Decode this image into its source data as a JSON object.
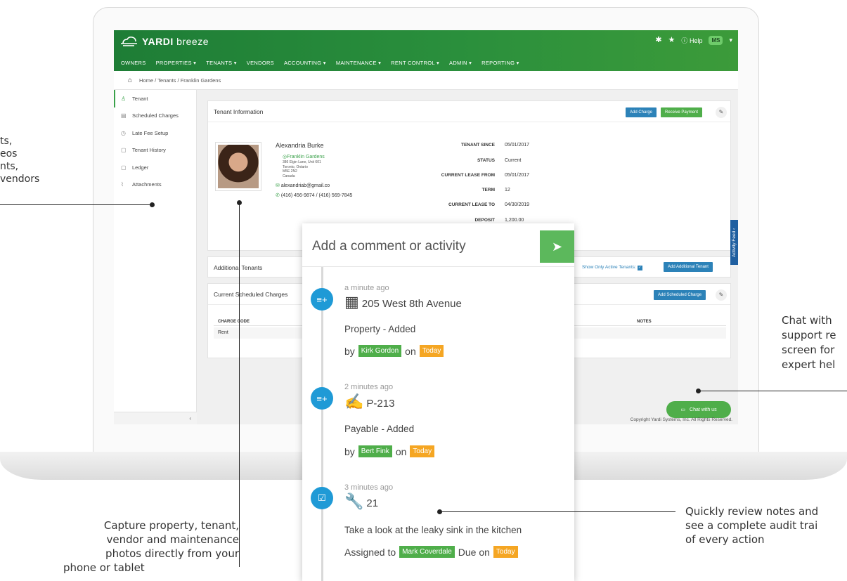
{
  "app": {
    "logo": "YARDI",
    "logo_suffix": "breeze",
    "help": "Help",
    "user_initials": "MS"
  },
  "nav": [
    "OWNERS",
    "PROPERTIES ▾",
    "TENANTS ▾",
    "VENDORS",
    "ACCOUNTING ▾",
    "MAINTENANCE ▾",
    "RENT CONTROL ▾",
    "ADMIN ▾",
    "REPORTING ▾"
  ],
  "breadcrumb": "Home / Tenants / Franklin Gardens",
  "sidebar": {
    "items": [
      {
        "label": "Tenant",
        "icon": "user-icon"
      },
      {
        "label": "Scheduled Charges",
        "icon": "calendar-icon"
      },
      {
        "label": "Late Fee Setup",
        "icon": "clock-icon"
      },
      {
        "label": "Tenant History",
        "icon": "document-icon"
      },
      {
        "label": "Ledger",
        "icon": "ledger-icon"
      },
      {
        "label": "Attachments",
        "icon": "paperclip-icon"
      }
    ],
    "collapse": "‹"
  },
  "tenant_info": {
    "title": "Tenant Information",
    "add_charge": "Add Charge",
    "receive_payment": "Receive Payment",
    "name": "Alexandria Burke",
    "property": "Franklin Gardens",
    "address": [
      "386 Elgin Lane, Unit 601",
      "Toronto, Ontario",
      "M5E 2N2",
      "Canada"
    ],
    "email": "alexandriab@gmail.co",
    "phone": "(416) 456-9874  /  (416) 569-7845",
    "fields": [
      {
        "key": "TENANT SINCE",
        "value": "05/01/2017"
      },
      {
        "key": "STATUS",
        "value": "Current"
      },
      {
        "key": "CURRENT LEASE FROM",
        "value": "05/01/2017"
      },
      {
        "key": "TERM",
        "value": "12"
      },
      {
        "key": "CURRENT LEASE TO",
        "value": "04/30/2019"
      },
      {
        "key": "DEPOSIT",
        "value": "1,200.00"
      }
    ]
  },
  "additional_tenants": {
    "title": "Additional Tenants",
    "filter_label": "Show Only Active Tenants:",
    "add_button": "Add Additional Tenant"
  },
  "scheduled_charges": {
    "title": "Current Scheduled Charges",
    "add_button": "Add Scheduled Charge",
    "col_code": "CHARGE CODE",
    "col_notes": "NOTES",
    "row_code": "Rent"
  },
  "activity_tab": "Activity Feed ‹",
  "chat": "Chat with us",
  "copyright": "Copyright Yardi Systems, Inc. All Rights Reserved.",
  "feed": {
    "placeholder": "Add a comment or activity",
    "items": [
      {
        "time": "a minute ago",
        "title": "205 West 8th Avenue",
        "desc": "Property - Added",
        "prefix": "by",
        "person": "Kirk Gordon",
        "mid": "on",
        "when": "Today"
      },
      {
        "time": "2 minutes ago",
        "title": "P-213",
        "desc": "Payable - Added",
        "prefix": "by",
        "person": "Bert Fink",
        "mid": "on",
        "when": "Today"
      },
      {
        "time": "3 minutes ago",
        "title": "21",
        "desc": "Take a look at the leaky sink in the kitchen",
        "prefix": "Assigned to",
        "person": "Mark Coverdale",
        "mid": "Due on",
        "when": "Today"
      }
    ]
  },
  "callouts": {
    "left": [
      "ts,",
      "eos",
      "nts,",
      "vendors"
    ],
    "right": [
      "Chat with",
      "support re",
      "screen for",
      "expert hel"
    ],
    "bottom_left": [
      "Capture property, tenant,",
      "vendor and maintenance",
      "photos directly from your",
      "phone or tablet"
    ],
    "bottom_right": [
      "Quickly review notes and",
      "see a complete audit trai",
      "of every action"
    ]
  }
}
